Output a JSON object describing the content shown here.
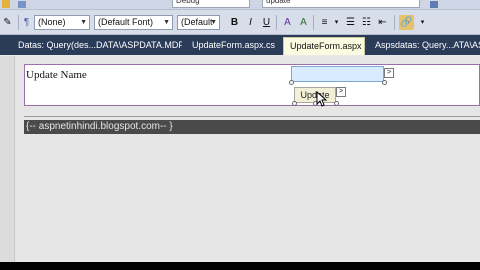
{
  "toolbar_top": {
    "config_value": "Debug",
    "target_value": "update"
  },
  "format_toolbar": {
    "style_select": "(None)",
    "font_select": "(Default Font)",
    "size_select": "(Default",
    "bold": "B",
    "italic": "I",
    "underline": "U"
  },
  "tabs": [
    {
      "label": "Datas: Query(des...DATA\\ASPDATA.MDF)"
    },
    {
      "label": "UpdateForm.aspx.cs"
    },
    {
      "label": "UpdateForm.aspx"
    },
    {
      "label": "Aspsdatas: Query...ATA\\ASPDATA.MDF)"
    }
  ],
  "close_glyph": "×",
  "designer": {
    "form_label": "Update Name",
    "button_label": "Update",
    "smart_tag_glyph": ">",
    "footer_text": "{-- aspnetinhindi.blogspot.com-- }"
  },
  "colors": {
    "tab_bar": "#2b3c59",
    "active_tab": "#fbfbe2",
    "form_border": "#9b6fa8",
    "footer_bg": "#4a4a4a"
  }
}
